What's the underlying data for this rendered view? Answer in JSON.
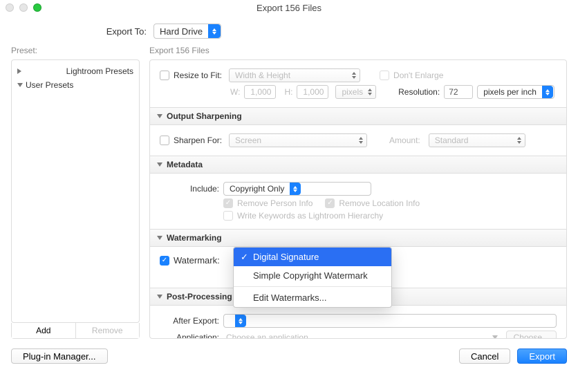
{
  "window": {
    "title": "Export 156 Files"
  },
  "exportTo": {
    "label": "Export To:",
    "value": "Hard Drive"
  },
  "presets": {
    "label": "Preset:",
    "items": [
      "Lightroom Presets",
      "User Presets"
    ],
    "addLabel": "Add",
    "removeLabel": "Remove"
  },
  "rightHeader": "Export 156 Files",
  "resize": {
    "cbLabel": "Resize to Fit:",
    "mode": "Width & Height",
    "dontEnlarge": "Don't Enlarge",
    "wLabel": "W:",
    "wValue": "1,000",
    "hLabel": "H:",
    "hValue": "1,000",
    "unit": "pixels",
    "resolutionLabel": "Resolution:",
    "resolutionValue": "72",
    "resolutionUnit": "pixels per inch"
  },
  "sharpening": {
    "title": "Output Sharpening",
    "cbLabel": "Sharpen For:",
    "forValue": "Screen",
    "amountLabel": "Amount:",
    "amountValue": "Standard"
  },
  "metadata": {
    "title": "Metadata",
    "includeLabel": "Include:",
    "includeValue": "Copyright Only",
    "removePerson": "Remove Person Info",
    "removeLocation": "Remove Location Info",
    "writeKeywords": "Write Keywords as Lightroom Hierarchy"
  },
  "watermarking": {
    "title": "Watermarking",
    "cbLabel": "Watermark:",
    "selected": "Digital Signature",
    "options": [
      "Digital Signature",
      "Simple Copyright Watermark"
    ],
    "editLabel": "Edit Watermarks..."
  },
  "post": {
    "title": "Post-Processing",
    "afterLabel": "After Export:",
    "appLabel": "Application:",
    "appPlaceholder": "Choose an application...",
    "chooseLabel": "Choose..."
  },
  "footer": {
    "pluginManager": "Plug-in Manager...",
    "cancel": "Cancel",
    "export": "Export"
  }
}
